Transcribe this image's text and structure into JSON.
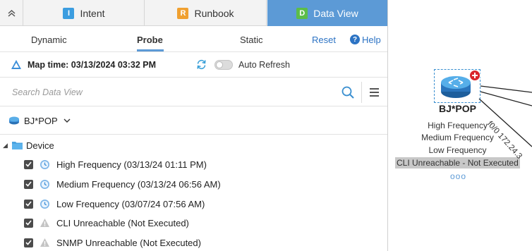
{
  "tabs": {
    "intent": {
      "badge": "I",
      "label": "Intent"
    },
    "runbook": {
      "badge": "R",
      "label": "Runbook"
    },
    "dataview": {
      "badge": "D",
      "label": "Data View"
    }
  },
  "subtabs": {
    "dynamic": "Dynamic",
    "probe": "Probe",
    "static": "Static",
    "reset": "Reset",
    "help": "Help",
    "active": "Probe"
  },
  "maptime": {
    "text": "Map time: 03/13/2024 03:32 PM",
    "auto_refresh_label": "Auto Refresh",
    "auto_refresh_on": false
  },
  "search": {
    "placeholder": "Search Data View"
  },
  "map_selector": {
    "value": "BJ*POP"
  },
  "tree": {
    "root_label": "Device",
    "items": [
      {
        "label": "High Frequency (03/13/24 01:11 PM)",
        "checked": true,
        "icon": "clock-icon"
      },
      {
        "label": "Medium Frequency (03/13/24 06:56 AM)",
        "checked": true,
        "icon": "clock-icon"
      },
      {
        "label": "Low Frequency (03/07/24 07:56 AM)",
        "checked": true,
        "icon": "clock-icon"
      },
      {
        "label": "CLI Unreachable (Not Executed)",
        "checked": true,
        "icon": "warning-icon"
      },
      {
        "label": "SNMP Unreachable (Not Executed)",
        "checked": true,
        "icon": "warning-icon"
      }
    ]
  },
  "canvas": {
    "device_name": "BJ*POP",
    "labels": [
      "High Frequency",
      "Medium Frequency",
      "Low Frequency"
    ],
    "highlight_label": "CLI Unreachable - Not Executed",
    "more": "ooo",
    "link_label": "f0/0 172.24.3"
  },
  "colors": {
    "accent": "#5c9ad6",
    "link": "#2c73c4"
  }
}
